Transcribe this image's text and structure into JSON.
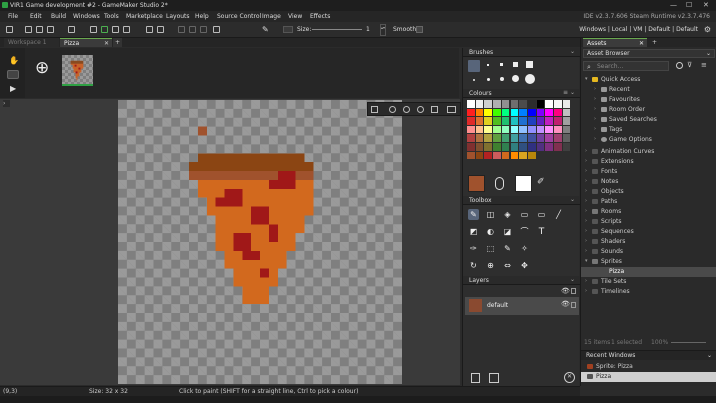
{
  "window": {
    "title": "VIR1 Game development #2 - GameMaker Studio 2*",
    "controls": [
      "—",
      "☐",
      "✕"
    ]
  },
  "menu": [
    "File",
    "Edit",
    "Build",
    "Windows",
    "Tools",
    "Marketplace",
    "Layouts",
    "Help",
    "Source Control",
    "Image",
    "View",
    "Effects"
  ],
  "menu_right": "IDE v2.3.7.606 Steam  Runtime v2.3.7.476",
  "toolbar": {
    "size_label": "Size:",
    "size_value": "1",
    "smooth_label": "Smooth",
    "right_text": "Windows | Local | VM | Default | Default"
  },
  "tabs": {
    "workspace": "Workspace 1",
    "pizza": "Pizza",
    "add": "+"
  },
  "frames": {
    "add_icon": "⊕",
    "frame_icon": "pizza-thumb"
  },
  "status": {
    "coords": "(9,3)",
    "size": "Size: 32 x 32",
    "hint": "Click to paint (SHIFT for a straight line, Ctrl to pick a colour)"
  },
  "panels": {
    "brushes": "Brushes",
    "colours": "Colours",
    "toolbox": "Toolbox",
    "layers": "Layers",
    "layer_default": "default"
  },
  "palette": [
    "#ffffff",
    "#f0f0f0",
    "#cfcfcf",
    "#b0b0b0",
    "#909090",
    "#6e6e6e",
    "#4c4c4c",
    "#2c2c2c",
    "#000000",
    "#ffffff",
    "#f6f6f6",
    "#eaeaea",
    "#ff2020",
    "#ff8000",
    "#ffff00",
    "#40ff00",
    "#00ff80",
    "#00ffff",
    "#0080ff",
    "#0000ff",
    "#8000ff",
    "#ff00ff",
    "#ff0080",
    "#c0c0c0",
    "#e02a2a",
    "#e07030",
    "#e0d020",
    "#50c020",
    "#20c070",
    "#20c0c0",
    "#2070d0",
    "#2040c0",
    "#6020c0",
    "#c020c0",
    "#c02070",
    "#a0a0a0",
    "#ff9090",
    "#ffc090",
    "#ffff90",
    "#a0ff90",
    "#90ffc0",
    "#90ffff",
    "#90c0ff",
    "#9090ff",
    "#c090ff",
    "#ff90ff",
    "#ff90c0",
    "#808080",
    "#b04040",
    "#b07040",
    "#b0a040",
    "#60a040",
    "#40a070",
    "#40a0a0",
    "#4070b0",
    "#4050a0",
    "#7040a0",
    "#a040a0",
    "#a04070",
    "#606060",
    "#803030",
    "#805030",
    "#807030",
    "#408030",
    "#308050",
    "#308080",
    "#305080",
    "#303080",
    "#503080",
    "#803080",
    "#803050",
    "#404040",
    "#a0522d",
    "#8b4513",
    "#b22222",
    "#cd5c5c",
    "#d2691e",
    "#ff8c00",
    "#daa520",
    "#b8860b",
    "#2e2e2e",
    "#2e2e2e",
    "#2e2e2e",
    "#2e2e2e"
  ],
  "current_colours": {
    "primary": "#a0522d",
    "secondary": "#ffffff"
  },
  "assets": {
    "tab": "Assets",
    "title": "Asset Browser",
    "search_placeholder": "Search...",
    "quick_access": "Quick Access",
    "quick_items": [
      "Recent",
      "Favourites",
      "Room Order",
      "Saved Searches",
      "Tags",
      "Game Options"
    ],
    "groups": [
      "Animation Curves",
      "Extensions",
      "Fonts",
      "Notes",
      "Objects",
      "Paths",
      "Rooms",
      "Scripts",
      "Sequences",
      "Shaders",
      "Sounds",
      "Sprites"
    ],
    "sprite_child": "Pizza",
    "after": [
      "Tile Sets",
      "Timelines"
    ],
    "footer_items": "15 items",
    "footer_selected": "1 selected",
    "footer_zoom": "100%",
    "recent_title": "Recent Windows",
    "recent_items": [
      "Sprite: Pizza",
      "Pizza"
    ]
  },
  "zoom_icons": [
    "grid-icon",
    "zoom-out-icon",
    "zoom-in-icon",
    "zoom-fit-icon",
    "zoom-reset-icon",
    "fullscreen-icon",
    "background-icon"
  ]
}
